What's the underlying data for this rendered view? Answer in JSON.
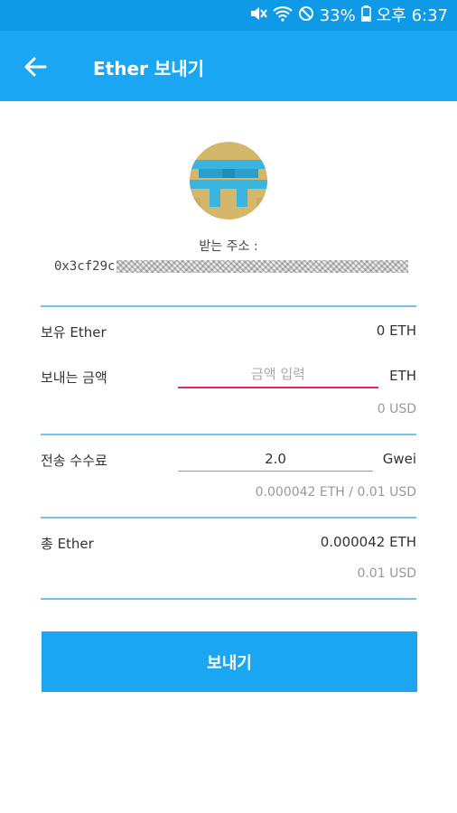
{
  "status_bar": {
    "battery": "33%",
    "time": "오후 6:37"
  },
  "app_bar": {
    "title": "Ether 보내기"
  },
  "recipient": {
    "label": "받는 주소 :",
    "address_visible": "0x3cf29c"
  },
  "balance": {
    "label": "보유 Ether",
    "value": "0 ETH"
  },
  "send_amount": {
    "label": "보내는 금액",
    "placeholder": "금액 입력",
    "value": "",
    "unit": "ETH",
    "usd": "0 USD"
  },
  "fee": {
    "label": "전송 수수료",
    "value": "2.0",
    "unit": "Gwei",
    "estimate": "0.000042 ETH / 0.01 USD"
  },
  "total": {
    "label": "총 Ether",
    "value": "0.000042 ETH",
    "usd": "0.01 USD"
  },
  "send_button": {
    "label": "보내기"
  },
  "colors": {
    "primary": "#1aa6f3",
    "status_bar": "#0f9ae8",
    "divider": "#6fc4ec",
    "input_focus": "#e6246c"
  }
}
